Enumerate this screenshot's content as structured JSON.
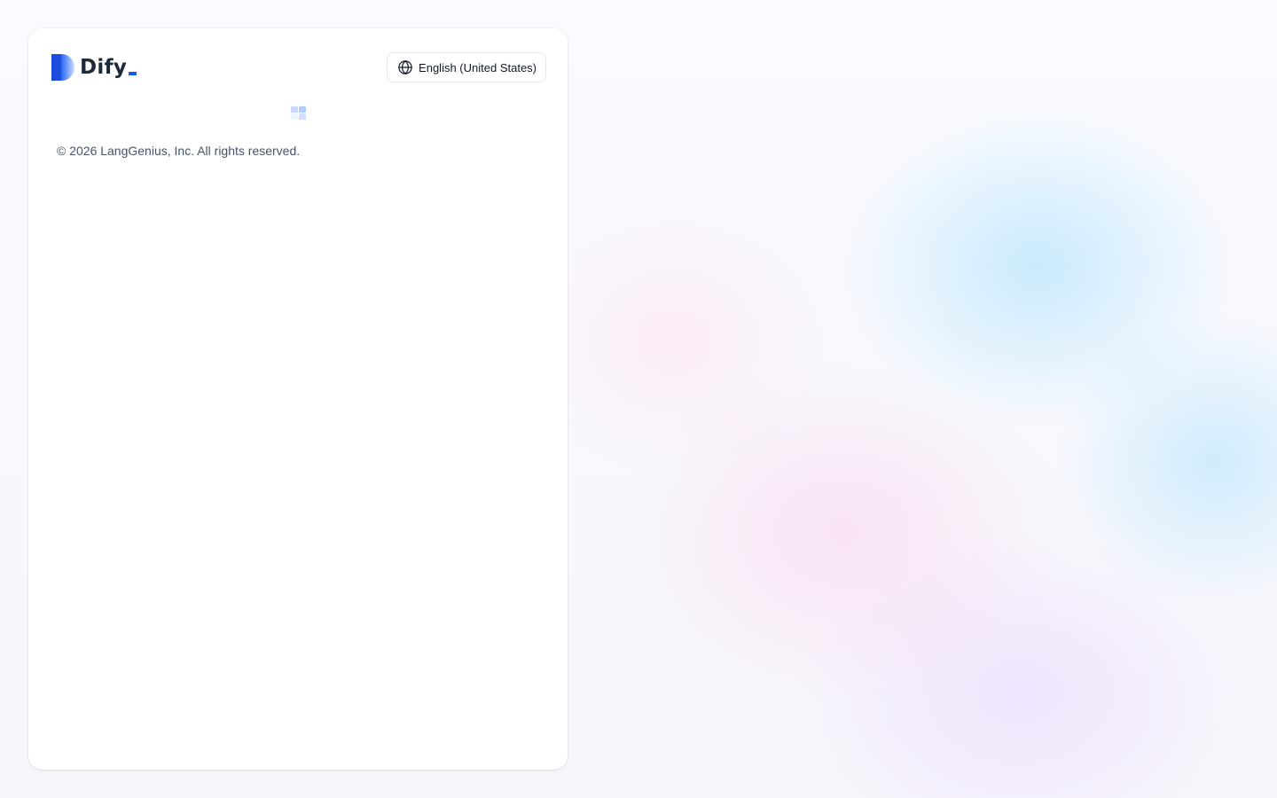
{
  "app": {
    "name": "Dify"
  },
  "language": {
    "selected": "English (United States)"
  },
  "footer": {
    "copyright": "© 2026 LangGenius, Inc. All rights reserved."
  },
  "colors": {
    "brand": "#155eef",
    "text": "#1d2939",
    "muted": "#475467"
  },
  "icons": {
    "language": "globe-icon",
    "loading": "loading-grid-icon"
  }
}
